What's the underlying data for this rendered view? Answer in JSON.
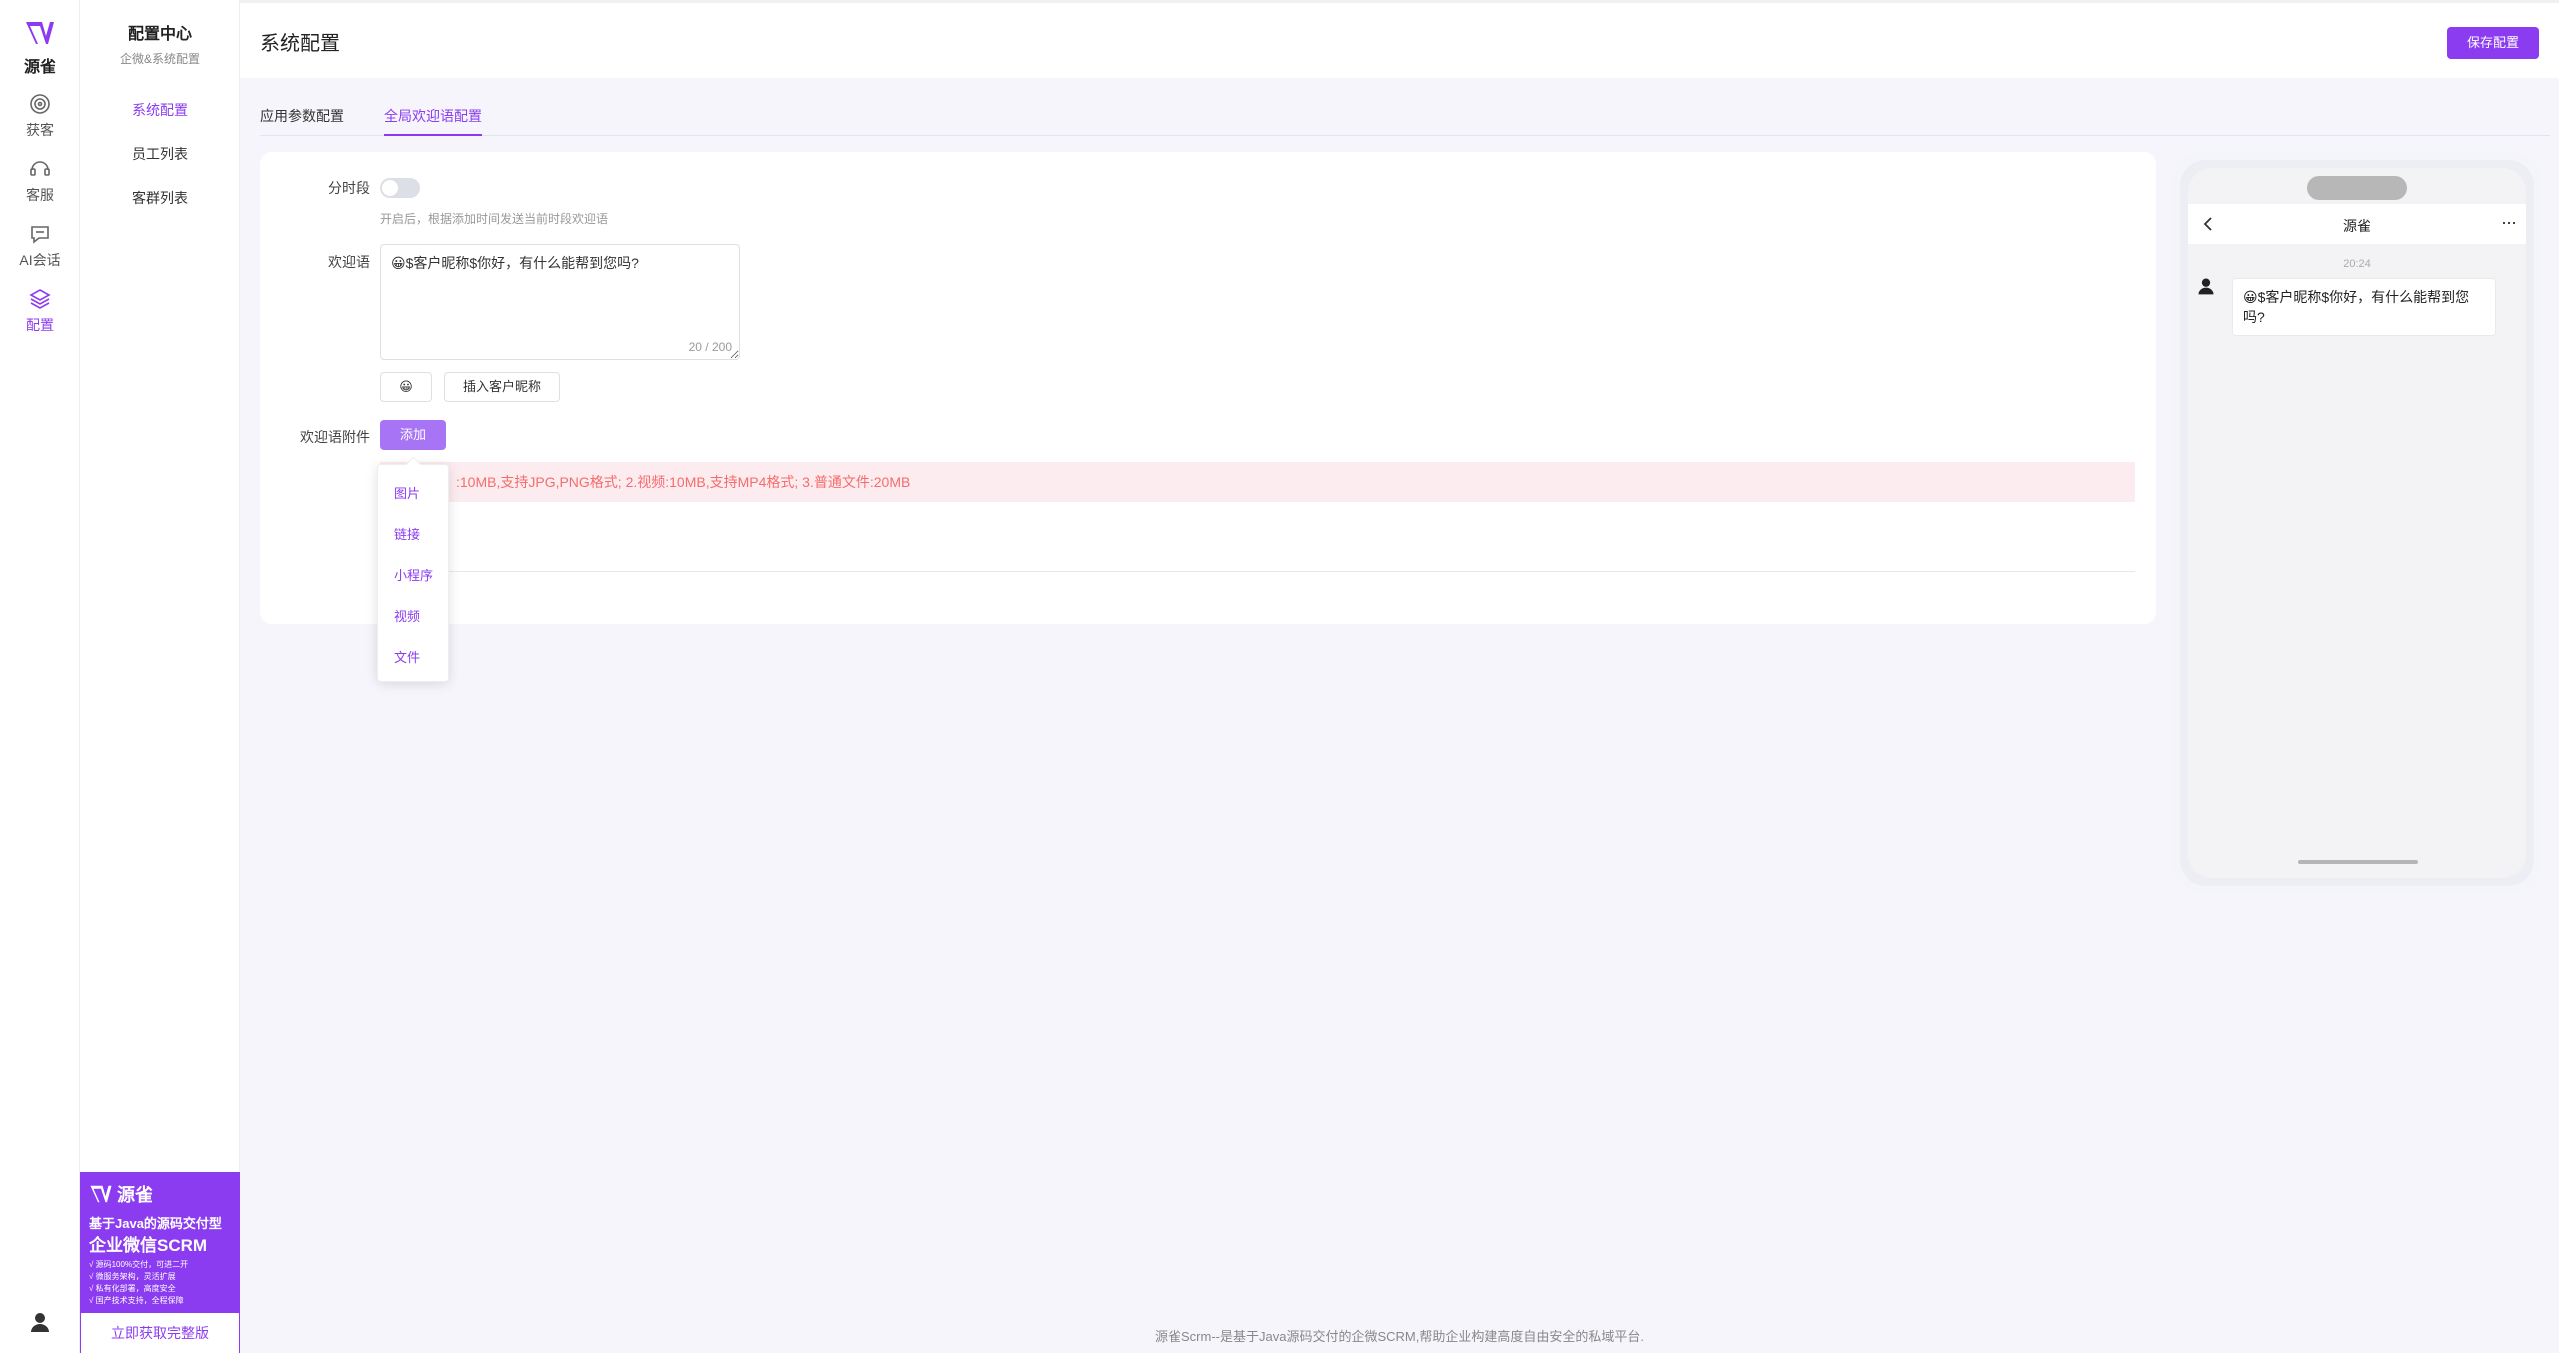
{
  "rail": {
    "brand": "源雀",
    "items": [
      {
        "label": "获客",
        "icon": "target-icon"
      },
      {
        "label": "客服",
        "icon": "headset-icon"
      },
      {
        "label": "AI会话",
        "icon": "chat-bubble-icon"
      },
      {
        "label": "配置",
        "icon": "layers-icon",
        "active": true
      }
    ]
  },
  "subnav": {
    "title": "配置中心",
    "subtitle": "企微&系统配置",
    "items": [
      "系统配置",
      "员工列表",
      "客群列表"
    ],
    "active_index": 0
  },
  "promo": {
    "brand": "源雀",
    "line1": "基于Java的源码交付型",
    "line2": "企业微信SCRM",
    "features": [
      "√ 源码100%交付，可进二开",
      "√ 微服务架构，灵活扩展",
      "√ 私有化部署，高度安全",
      "√ 国产技术支持，全程保障"
    ],
    "cta": "立即获取完整版"
  },
  "header": {
    "title": "系统配置",
    "save_label": "保存配置"
  },
  "tabs": [
    {
      "label": "应用参数配置",
      "active": false
    },
    {
      "label": "全局欢迎语配置",
      "active": true
    }
  ],
  "form": {
    "time_label": "分时段",
    "time_enabled": false,
    "time_hint": "开启后，根据添加时间发送当前时段欢迎语",
    "welcome_label": "欢迎语",
    "welcome_text": "😀$客户昵称$你好，有什么能帮到您吗?",
    "counter": "20 / 200",
    "emoji_button": "😀",
    "insert_nickname": "插入客户昵称",
    "attach_label": "欢迎语附件",
    "add_label": "添加",
    "alert_text": ":10MB,支持JPG,PNG格式; 2.视频:10MB,支持MP4格式; 3.普通文件:20MB"
  },
  "dropdown": [
    "图片",
    "链接",
    "小程序",
    "视频",
    "文件"
  ],
  "phone": {
    "title": "源雀",
    "more": "···",
    "time": "20:24",
    "message": "😀$客户昵称$你好，有什么能帮到您吗?"
  },
  "footer": "源雀Scrm--是基于Java源码交付的企微SCRM,帮助企业构建高度自由安全的私域平台.",
  "colors": {
    "accent": "#8b3cf0",
    "alert_bg": "#fdecef",
    "alert_text": "#f56c6c"
  }
}
